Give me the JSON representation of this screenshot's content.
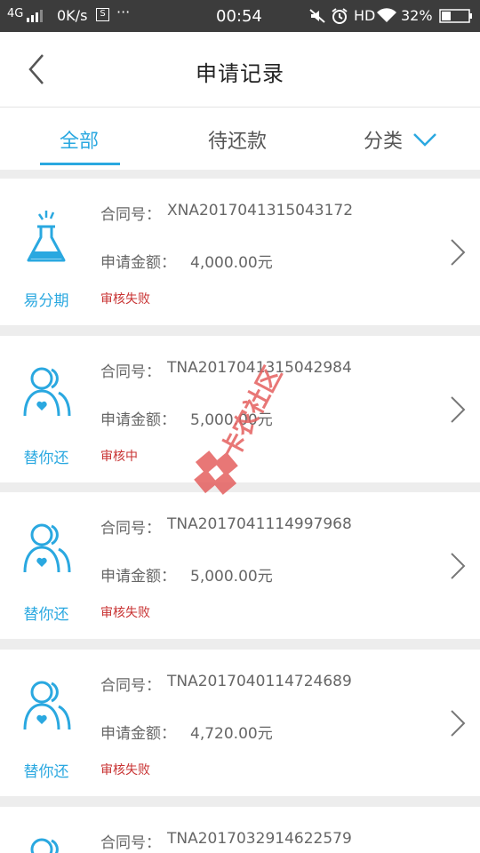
{
  "status_bar": {
    "network": "4G",
    "speed": "0K/s",
    "sim_badge": "S",
    "more": "···",
    "time": "00:54",
    "hd": "HD",
    "battery": "32%"
  },
  "header": {
    "title": "申请记录"
  },
  "tabs": {
    "all": "全部",
    "pending": "待还款",
    "category": "分类"
  },
  "labels": {
    "contract": "合同号：",
    "amount": "申请金额："
  },
  "records": [
    {
      "product": "易分期",
      "contract_no": "XNA2017041315043172",
      "amount": "4,000.00元",
      "status": "审核失败"
    },
    {
      "product": "替你还",
      "contract_no": "TNA2017041315042984",
      "amount": "5,000.00元",
      "status": "审核中"
    },
    {
      "product": "替你还",
      "contract_no": "TNA2017041114997968",
      "amount": "5,000.00元",
      "status": "审核失败"
    },
    {
      "product": "替你还",
      "contract_no": "TNA2017040114724689",
      "amount": "4,720.00元",
      "status": "审核失败"
    },
    {
      "product": "替你还",
      "contract_no": "TNA2017032914622579",
      "amount": "",
      "status": ""
    }
  ],
  "watermark": {
    "text": "卡农社区"
  },
  "colors": {
    "accent": "#2aa8e0",
    "status_fail": "#c83232",
    "status_bar": "#3c3c3c",
    "background": "#ededed"
  }
}
